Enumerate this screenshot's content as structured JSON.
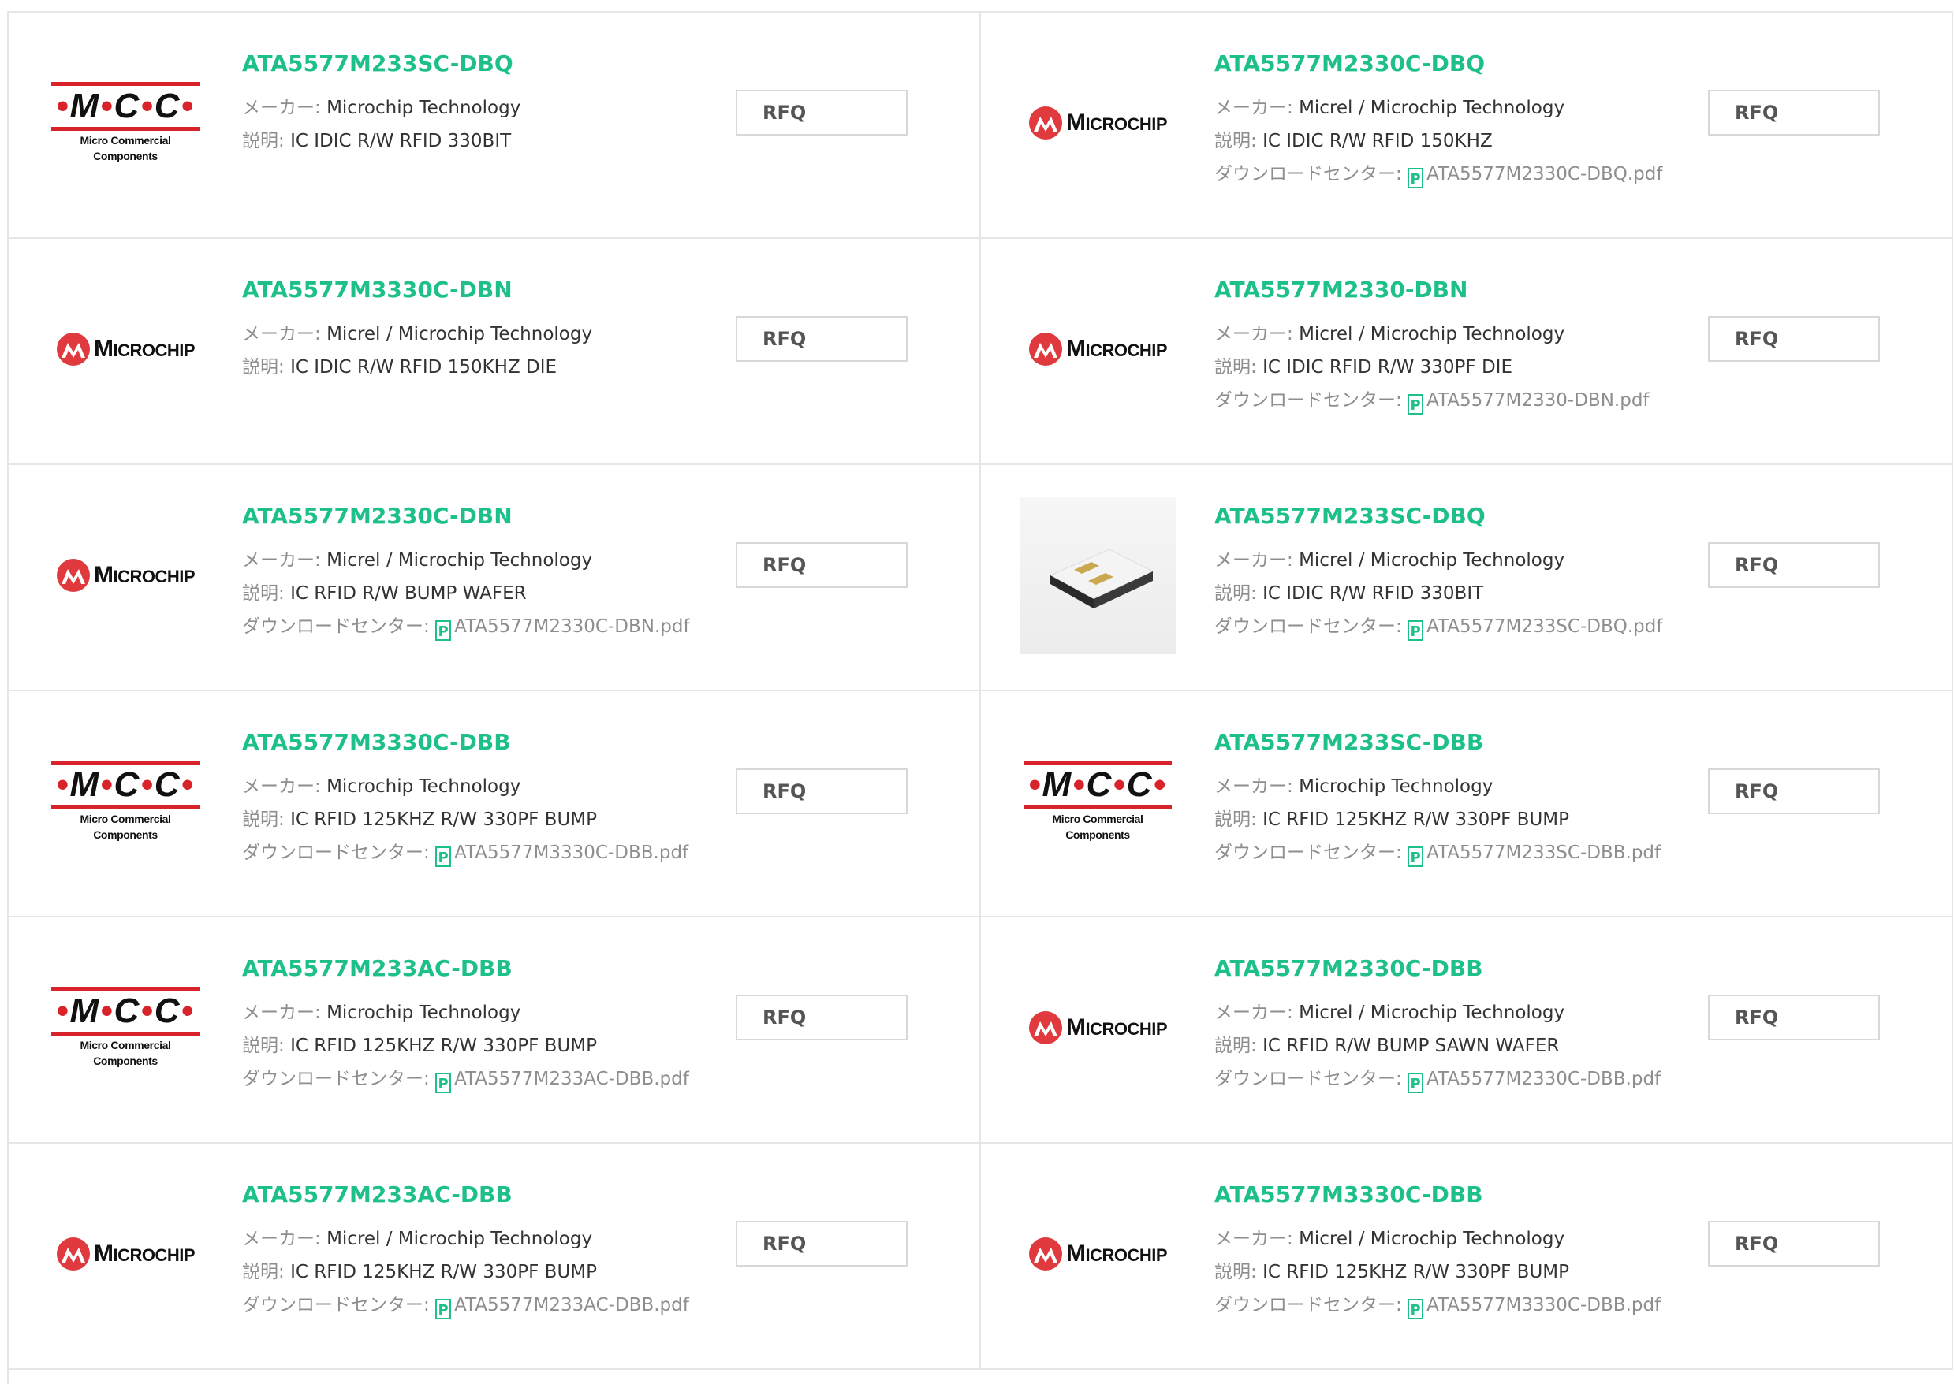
{
  "labels": {
    "maker": "メーカー: ",
    "desc": "説明: ",
    "download": "ダウンロードセンター: ",
    "rfq": "RFQ",
    "pdf_icon": "P"
  },
  "colors": {
    "part_link": "#1dbf8a",
    "mcc_red": "#d8232a",
    "microchip_red": "#e03a3e"
  },
  "logos": {
    "mcc_letters": [
      "M",
      "C",
      "C"
    ],
    "mcc_dot": "•",
    "mcc_sub": "Micro Commercial Components",
    "microchip_first": "M",
    "microchip_rest": "ICROCHIP"
  },
  "items": [
    {
      "part": "ATA5577M233SC-DBQ",
      "maker": "Microchip Technology",
      "desc": "IC IDIC R/W RFID 330BIT",
      "pdf": "",
      "logo": "mcc"
    },
    {
      "part": "ATA5577M2330C-DBQ",
      "maker": "Micrel / Microchip Technology",
      "desc": "IC IDIC R/W RFID 150KHZ",
      "pdf": "ATA5577M2330C-DBQ.pdf",
      "logo": "microchip"
    },
    {
      "part": "ATA5577M3330C-DBN",
      "maker": "Micrel / Microchip Technology",
      "desc": "IC IDIC R/W RFID 150KHZ DIE",
      "pdf": "",
      "logo": "microchip"
    },
    {
      "part": "ATA5577M2330-DBN",
      "maker": "Micrel / Microchip Technology",
      "desc": "IC IDIC RFID R/W 330PF DIE",
      "pdf": "ATA5577M2330-DBN.pdf",
      "logo": "microchip"
    },
    {
      "part": "ATA5577M2330C-DBN",
      "maker": "Micrel / Microchip Technology",
      "desc": "IC RFID R/W BUMP WAFER",
      "pdf": "ATA5577M2330C-DBN.pdf",
      "logo": "microchip"
    },
    {
      "part": "ATA5577M233SC-DBQ",
      "maker": "Micrel / Microchip Technology",
      "desc": "IC IDIC R/W RFID 330BIT",
      "pdf": "ATA5577M233SC-DBQ.pdf",
      "logo": "chip-photo"
    },
    {
      "part": "ATA5577M3330C-DBB",
      "maker": "Microchip Technology",
      "desc": "IC RFID 125KHZ R/W 330PF BUMP",
      "pdf": "ATA5577M3330C-DBB.pdf",
      "logo": "mcc"
    },
    {
      "part": "ATA5577M233SC-DBB",
      "maker": "Microchip Technology",
      "desc": "IC RFID 125KHZ R/W 330PF BUMP",
      "pdf": "ATA5577M233SC-DBB.pdf",
      "logo": "mcc"
    },
    {
      "part": "ATA5577M233AC-DBB",
      "maker": "Microchip Technology",
      "desc": "IC RFID 125KHZ R/W 330PF BUMP",
      "pdf": "ATA5577M233AC-DBB.pdf",
      "logo": "mcc"
    },
    {
      "part": "ATA5577M2330C-DBB",
      "maker": "Micrel / Microchip Technology",
      "desc": "IC RFID R/W BUMP SAWN WAFER",
      "pdf": "ATA5577M2330C-DBB.pdf",
      "logo": "microchip"
    },
    {
      "part": "ATA5577M233AC-DBB",
      "maker": "Micrel / Microchip Technology",
      "desc": "IC RFID 125KHZ R/W 330PF BUMP",
      "pdf": "ATA5577M233AC-DBB.pdf",
      "logo": "microchip"
    },
    {
      "part": "ATA5577M3330C-DBB",
      "maker": "Micrel / Microchip Technology",
      "desc": "IC RFID 125KHZ R/W 330PF BUMP",
      "pdf": "ATA5577M3330C-DBB.pdf",
      "logo": "microchip"
    }
  ]
}
